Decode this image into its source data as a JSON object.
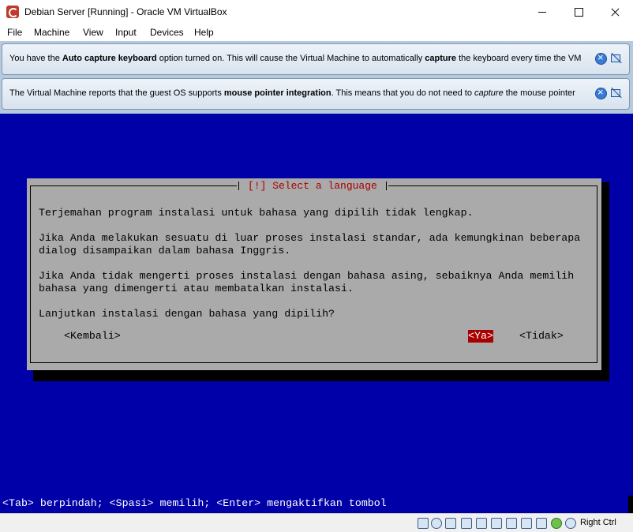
{
  "window": {
    "title": "Debian Server [Running] - Oracle VM VirtualBox",
    "controls": [
      "minimize",
      "maximize",
      "close"
    ]
  },
  "menu": {
    "items": [
      "File",
      "Machine",
      "View",
      "Input",
      "Devices",
      "Help"
    ]
  },
  "notifications": [
    {
      "parts": [
        {
          "text": "You have the ",
          "bold": false
        },
        {
          "text": "Auto capture keyboard",
          "bold": true
        },
        {
          "text": " option turned on. This will cause the Virtual Machine to automatically ",
          "bold": false
        },
        {
          "text": "capture",
          "bold": true
        },
        {
          "text": " the keyboard every time the VM",
          "bold": false
        }
      ]
    },
    {
      "parts": [
        {
          "text": "The Virtual Machine reports that the guest OS supports ",
          "bold": false
        },
        {
          "text": "mouse pointer integration",
          "bold": true
        },
        {
          "text": ". This means that you do not need to ",
          "bold": false
        },
        {
          "text": "capture",
          "italic": true
        },
        {
          "text": " the mouse pointer",
          "bold": false
        }
      ]
    }
  ],
  "installer": {
    "title": "[!] Select a language",
    "paragraphs": [
      "Terjemahan program instalasi untuk bahasa yang dipilih tidak lengkap.",
      "Jika Anda melakukan sesuatu di luar proses instalasi standar, ada kemungkinan beberapa",
      "dialog disampaikan dalam bahasa Inggris.",
      "Jika Anda tidak mengerti proses instalasi dengan bahasa asing, sebaiknya Anda memilih",
      "bahasa yang dimengerti atau membatalkan instalasi.",
      "Lanjutkan instalasi dengan bahasa yang dipilih?"
    ],
    "buttons": {
      "back": "<Kembali>",
      "yes": "<Ya>",
      "no": "<Tidak>"
    },
    "footer": "<Tab> berpindah; <Spasi> memilih; <Enter> mengaktifkan tombol"
  },
  "statusbar": {
    "host_key": "Right Ctrl",
    "icons": [
      "hard-disk-icon",
      "optical-drive-icon",
      "audio-icon",
      "network-icon",
      "usb-icon",
      "shared-folders-icon",
      "display-icon",
      "video-capture-icon",
      "cpu-icon",
      "mouse-integration-icon",
      "keyboard-capture-icon",
      "arrow-down-icon"
    ]
  }
}
